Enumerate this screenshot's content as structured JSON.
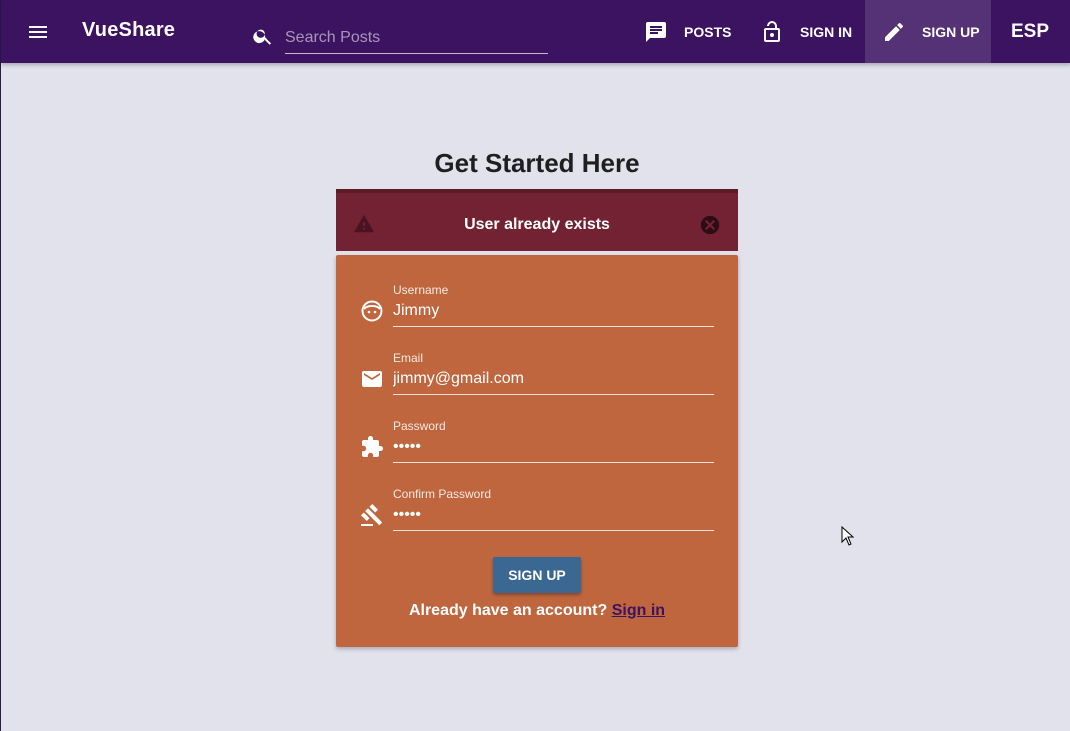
{
  "app": {
    "title": "VueShare"
  },
  "search": {
    "placeholder": "Search Posts",
    "value": ""
  },
  "nav": {
    "posts": "POSTS",
    "signin": "SIGN IN",
    "signup": "SIGN UP",
    "language": "ESP"
  },
  "page": {
    "heading": "Get Started Here"
  },
  "alert": {
    "message": "User already exists"
  },
  "form": {
    "username": {
      "label": "Username",
      "value": "Jimmy"
    },
    "email": {
      "label": "Email",
      "value": "jimmy@gmail.com"
    },
    "password": {
      "label": "Password",
      "value": "12345"
    },
    "confirm": {
      "label": "Confirm Password",
      "value": "12345"
    },
    "submit_label": "SIGN UP",
    "footer_text": "Already have an account?",
    "footer_link": "Sign in"
  },
  "colors": {
    "toolbar": "#3c1361",
    "background": "#e1e2ec",
    "alert": "#722232",
    "card": "#c0663f",
    "submit": "#3b6793"
  },
  "icons": {
    "menu": "menu-icon",
    "search": "search-icon",
    "posts": "chat-icon",
    "signin": "lock-open-icon",
    "signup": "pencil-icon",
    "alert": "warning-icon",
    "close": "close-circle-icon",
    "username": "face-icon",
    "email": "email-icon",
    "password": "puzzle-icon",
    "confirm": "gavel-icon"
  }
}
